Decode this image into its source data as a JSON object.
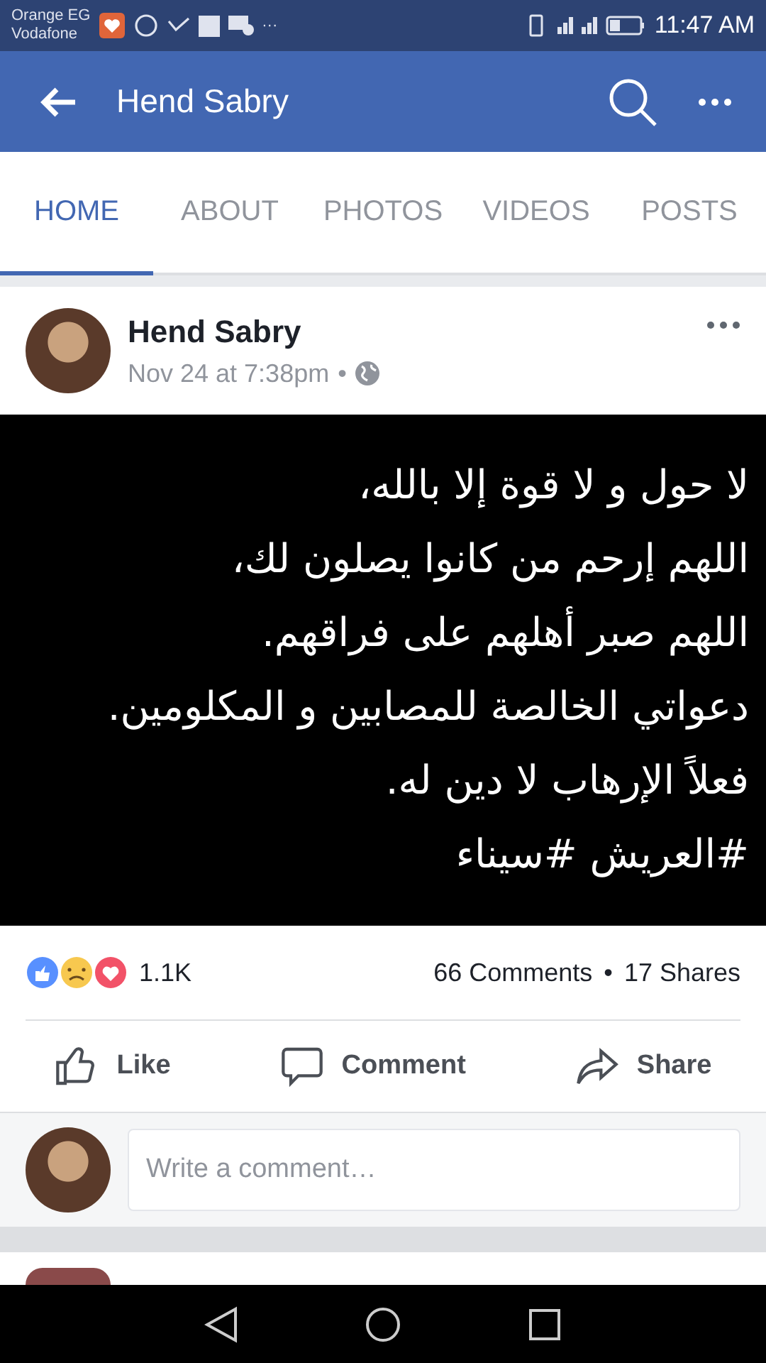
{
  "status_bar": {
    "carriers": [
      "Orange EG",
      "Vodafone"
    ],
    "time": "11:47 AM",
    "more": "···"
  },
  "app_bar": {
    "title": "Hend Sabry"
  },
  "tabs": [
    {
      "label": "HOME",
      "selected": true
    },
    {
      "label": "ABOUT",
      "selected": false
    },
    {
      "label": "PHOTOS",
      "selected": false
    },
    {
      "label": "VIDEOS",
      "selected": false
    },
    {
      "label": "POSTS",
      "selected": false
    }
  ],
  "post": {
    "author": "Hend Sabry",
    "time": "Nov 24 at 7:38pm",
    "separator": "•",
    "image_text": [
      "لا حول و لا قوة إلا بالله،",
      "اللهم إرحم من كانوا يصلون لك،",
      "اللهم صبر أهلهم على فراقهم.",
      "دعواتي الخالصة للمصابين و المكلومين.",
      "فعلاً الإرهاب لا دين له.",
      "#العريش #سيناء"
    ],
    "reaction_count": "1.1K",
    "comments": "66 Comments",
    "shares": "17 Shares",
    "actions": [
      {
        "kind": "like",
        "label": "Like"
      },
      {
        "kind": "comment",
        "label": "Comment"
      },
      {
        "kind": "share",
        "label": "Share"
      }
    ],
    "comment_field": {
      "placeholder": "Write a comment…"
    }
  }
}
